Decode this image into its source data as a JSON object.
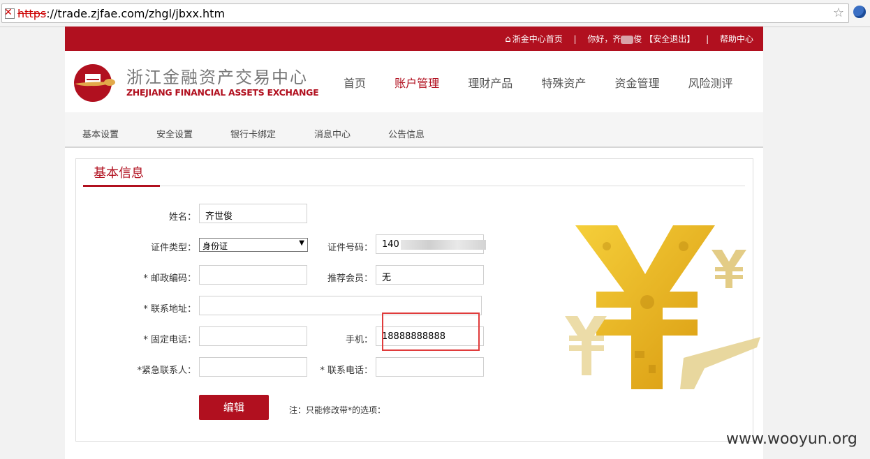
{
  "browser": {
    "url_scheme": "https",
    "url_rest": "://trade.zjfae.com/zhgl/jbxx.htm"
  },
  "topbar": {
    "home_link": "浙金中心首页",
    "greeting": "你好，齐",
    "greeting_end": "俊",
    "logout": "【安全退出】",
    "help": "帮助中心"
  },
  "logo": {
    "cn": "浙江金融资产交易中心",
    "en": "ZHEJIANG FINANCIAL ASSETS EXCHANGE"
  },
  "main_nav": [
    "首页",
    "账户管理",
    "理财产品",
    "特殊资产",
    "资金管理",
    "风险测评"
  ],
  "main_nav_active": "账户管理",
  "sub_nav": [
    "基本设置",
    "安全设置",
    "银行卡绑定",
    "消息中心",
    "公告信息"
  ],
  "panel": {
    "title": "基本信息",
    "fields": {
      "name_label": "姓名：",
      "name_value": "齐世俊",
      "idtype_label": "证件类型：",
      "idtype_value": "身份证",
      "idno_label": "证件号码：",
      "idno_value": "140",
      "postcode_label": "* 邮政编码：",
      "postcode_value": "",
      "referrer_label": "推荐会员：",
      "referrer_value": "无",
      "address_label": "* 联系地址：",
      "address_value": "",
      "phone_label": "* 固定电话：",
      "phone_value": "",
      "mobile_label": "手机：",
      "mobile_value": "18888888888",
      "emergency_label": "*紧急联系人：",
      "emergency_value": "",
      "contact_phone_label": "* 联系电话：",
      "contact_phone_value": ""
    },
    "edit_button": "编辑",
    "note": "注：只能修改带*的选项："
  },
  "watermark": "www.wooyun.org",
  "colors": {
    "brand_red": "#b1101f",
    "highlight_box": "#e03b3b",
    "gold": "#e8b820"
  }
}
